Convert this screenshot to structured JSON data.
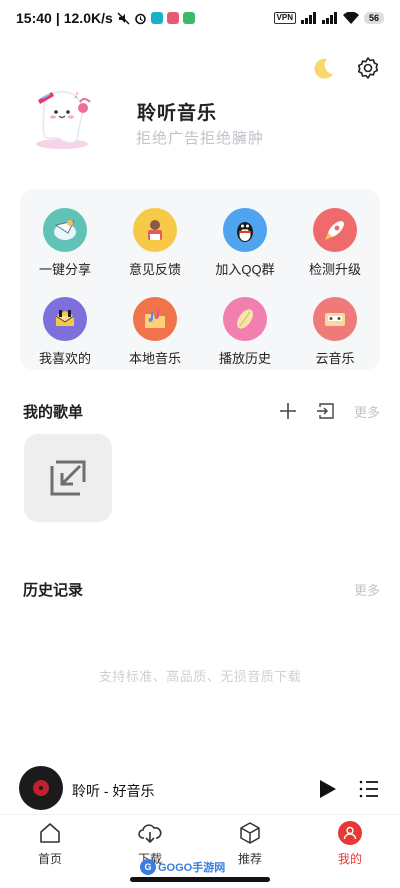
{
  "status_bar": {
    "time": "15:40",
    "net_speed": "12.0K/s",
    "vpn": "VPN",
    "battery": "56",
    "colors": {
      "text": "#111111"
    }
  },
  "header": {
    "night_mode_icon": "moon-icon",
    "settings_icon": "gear-icon",
    "app_name": "聆听音乐",
    "slogan": "拒绝广告拒绝臃肿"
  },
  "shortcuts": [
    {
      "label": "一键分享",
      "icon": "share-icon",
      "color": "#61c3b6"
    },
    {
      "label": "意见反馈",
      "icon": "feedback-icon",
      "color": "#f7c948"
    },
    {
      "label": "加入QQ群",
      "icon": "qq-penguin-icon",
      "color": "#4fa3ef"
    },
    {
      "label": "检测升级",
      "icon": "rocket-icon",
      "color": "#ef6b6b"
    },
    {
      "label": "我喜欢的",
      "icon": "like-icon",
      "color": "#7d6fdc"
    },
    {
      "label": "本地音乐",
      "icon": "folder-music-icon",
      "color": "#f0734b"
    },
    {
      "label": "播放历史",
      "icon": "history-icon",
      "color": "#f27fb0"
    },
    {
      "label": "云音乐",
      "icon": "cassette-icon",
      "color": "#ee7a7a"
    }
  ],
  "playlists": {
    "title": "我的歌单",
    "more": "更多"
  },
  "history": {
    "title": "历史记录",
    "more": "更多",
    "empty_hint": "支持标准、高品质、无损音质下载"
  },
  "player": {
    "track": "聆听 - 好音乐"
  },
  "bottom_nav": [
    {
      "label": "首页",
      "icon": "home-icon"
    },
    {
      "label": "下载",
      "icon": "cloud-download-icon"
    },
    {
      "label": "推荐",
      "icon": "cube-icon"
    },
    {
      "label": "我的",
      "icon": "user-icon"
    }
  ],
  "watermark": {
    "badge": "G",
    "text": "GOGO手游网"
  },
  "colors": {
    "accent": "#e53935",
    "card_bg": "#f6f7f9",
    "muted": "#c4c4c4"
  }
}
